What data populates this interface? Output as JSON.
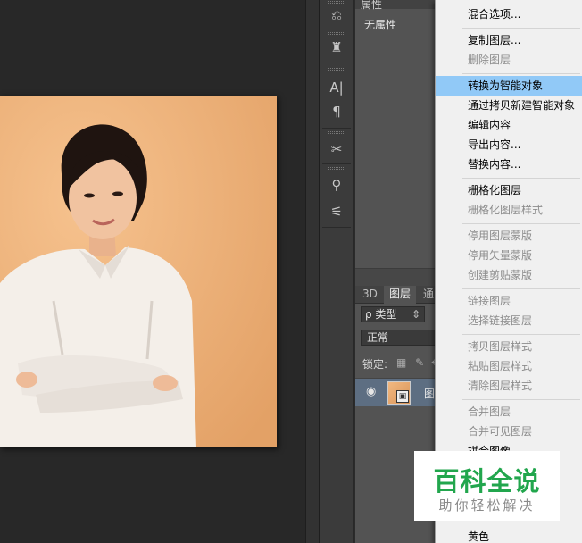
{
  "properties_panel": {
    "tab": "属性",
    "label": "无属性"
  },
  "layers_panel": {
    "tabs": [
      "3D",
      "图层",
      "通"
    ],
    "filter": "ρ 类型",
    "blend_mode": "正常",
    "lock_label": "锁定:",
    "layer_name": "图"
  },
  "context_menu": {
    "items": [
      {
        "label": "混合选项...",
        "disabled": false
      },
      {
        "label": "复制图层...",
        "disabled": false
      },
      {
        "label": "删除图层",
        "disabled": true
      },
      {
        "label": "转换为智能对象",
        "disabled": false,
        "highlighted": true
      },
      {
        "label": "通过拷贝新建智能对象",
        "disabled": false
      },
      {
        "label": "编辑内容",
        "disabled": false
      },
      {
        "label": "导出内容...",
        "disabled": false
      },
      {
        "label": "替换内容...",
        "disabled": false
      },
      {
        "label": "栅格化图层",
        "disabled": false
      },
      {
        "label": "栅格化图层样式",
        "disabled": true
      },
      {
        "label": "停用图层蒙版",
        "disabled": true
      },
      {
        "label": "停用矢量蒙版",
        "disabled": true
      },
      {
        "label": "创建剪贴蒙版",
        "disabled": true
      },
      {
        "label": "链接图层",
        "disabled": true
      },
      {
        "label": "选择链接图层",
        "disabled": true
      },
      {
        "label": "拷贝图层样式",
        "disabled": true
      },
      {
        "label": "粘贴图层样式",
        "disabled": true
      },
      {
        "label": "清除图层样式",
        "disabled": true
      },
      {
        "label": "合并图层",
        "disabled": true
      },
      {
        "label": "合并可见图层",
        "disabled": true
      },
      {
        "label": "拼合图像",
        "disabled": false
      },
      {
        "label": "黄色",
        "disabled": false
      }
    ]
  },
  "watermark": {
    "title": "百科全说",
    "subtitle": "助你轻松解决"
  },
  "tools": [
    "history-icon",
    "clone-source-icon",
    "character-icon",
    "paragraph-icon",
    "tool-presets-icon",
    "brush-icon",
    "brush-presets-icon"
  ]
}
